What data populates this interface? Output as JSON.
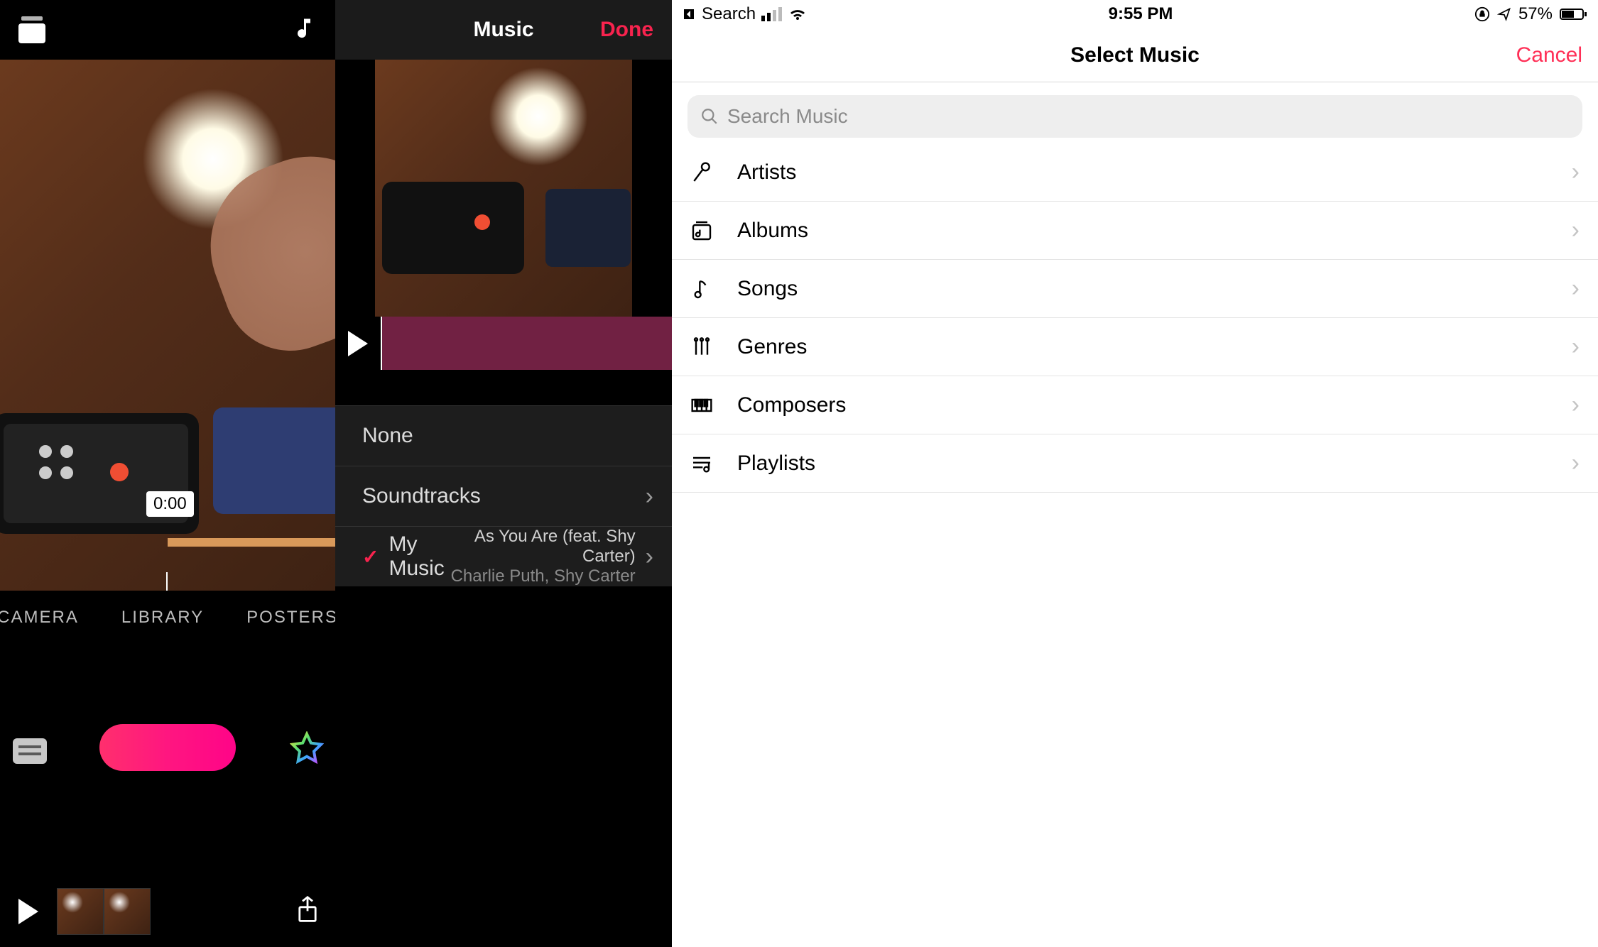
{
  "panel1": {
    "timestamp": "0:00",
    "tabs": {
      "camera": "CAMERA",
      "library": "LIBRARY",
      "posters": "POSTERS"
    }
  },
  "panel2": {
    "nav": {
      "title": "Music",
      "done": "Done"
    },
    "items": {
      "none": "None",
      "soundtracks": "Soundtracks",
      "mymusic_label": "My Music",
      "mymusic_track": "As You Are (feat. Shy Carter)",
      "mymusic_artist": "Charlie Puth, Shy Carter"
    }
  },
  "panel3": {
    "status": {
      "back_label": "Search",
      "time": "9:55 PM",
      "battery_pct": "57%"
    },
    "nav": {
      "title": "Select Music",
      "cancel": "Cancel"
    },
    "search_placeholder": "Search Music",
    "rows": {
      "artists": "Artists",
      "albums": "Albums",
      "songs": "Songs",
      "genres": "Genres",
      "composers": "Composers",
      "playlists": "Playlists"
    }
  }
}
